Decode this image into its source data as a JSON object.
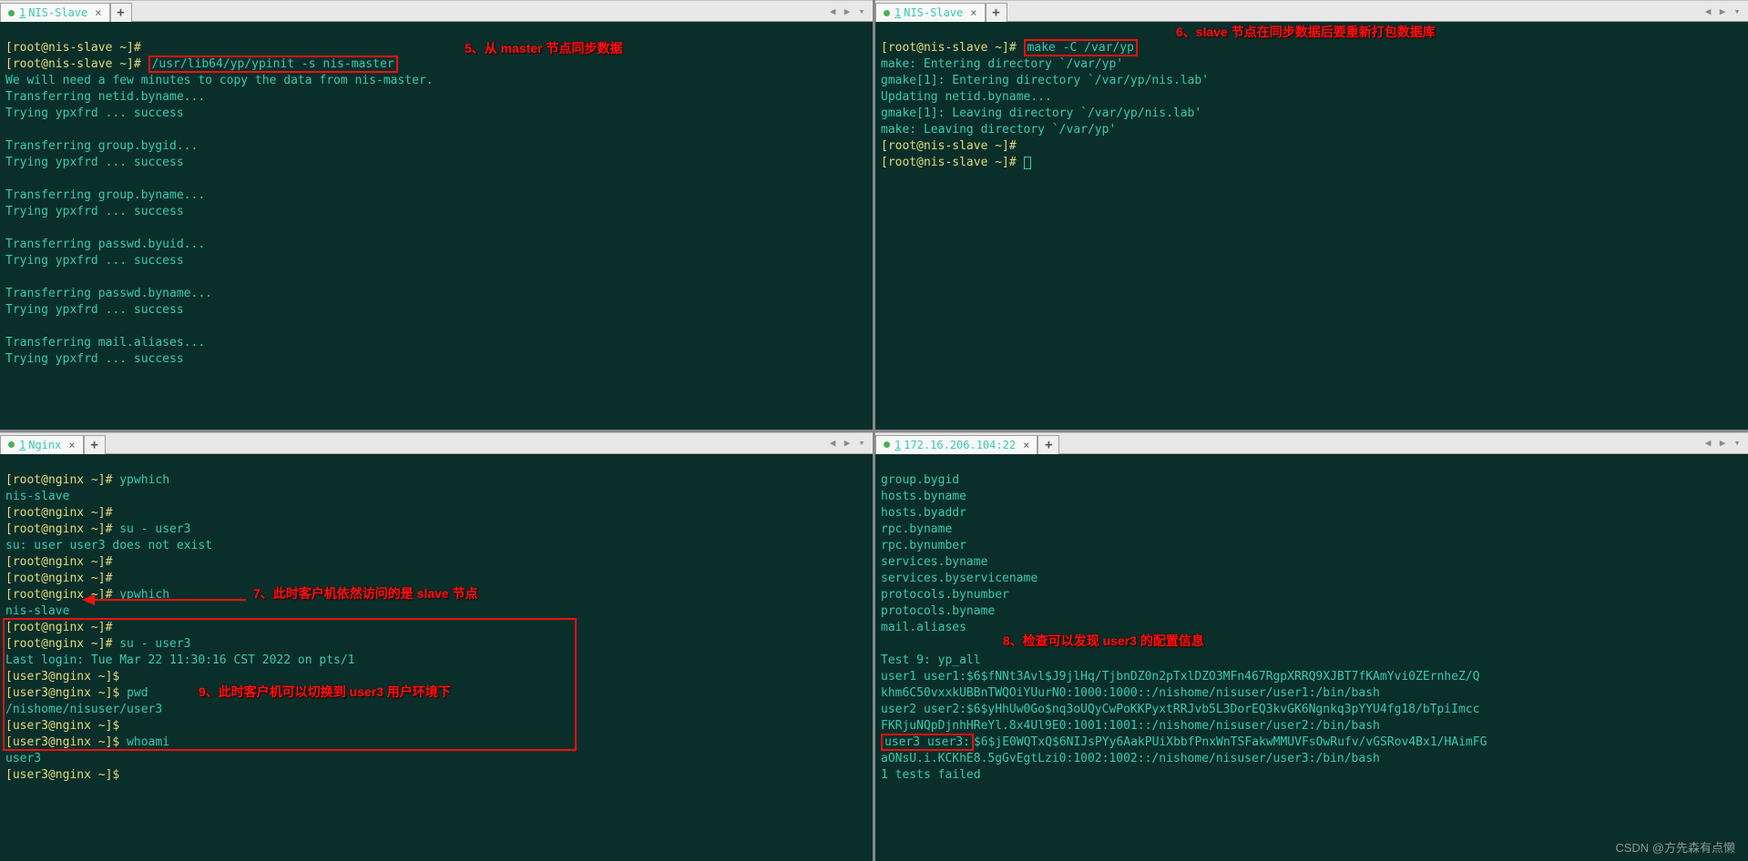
{
  "watermark": "CSDN @方先森有点懒",
  "panes": {
    "tl": {
      "tab": {
        "num": "1",
        "label": "NIS-Slave"
      },
      "annot5": "5、从 master 节点同步数据",
      "prompt1": "[root@nis-slave ~]#",
      "prompt2": "[root@nis-slave ~]#",
      "cmd2": "/usr/lib64/yp/ypinit -s nis-master",
      "lines": [
        "We will need a few minutes to copy the data from nis-master.",
        "Transferring netid.byname...",
        "Trying ypxfrd ... success",
        "",
        "Transferring group.bygid...",
        "Trying ypxfrd ... success",
        "",
        "Transferring group.byname...",
        "Trying ypxfrd ... success",
        "",
        "Transferring passwd.byuid...",
        "Trying ypxfrd ... success",
        "",
        "Transferring passwd.byname...",
        "Trying ypxfrd ... success",
        "",
        "Transferring mail.aliases...",
        "Trying ypxfrd ... success"
      ]
    },
    "tr": {
      "tab": {
        "num": "1",
        "label": "NIS-Slave"
      },
      "annot6": "6、slave 节点在同步数据后要重新打包数据库",
      "prompt1": "[root@nis-slave ~]#",
      "cmd1": "make -C /var/yp",
      "lines": [
        "make: Entering directory `/var/yp'",
        "gmake[1]: Entering directory `/var/yp/nis.lab'",
        "Updating netid.byname...",
        "gmake[1]: Leaving directory `/var/yp/nis.lab'",
        "make: Leaving directory `/var/yp'"
      ],
      "prompt2": "[root@nis-slave ~]#",
      "prompt3": "[root@nis-slave ~]#"
    },
    "bl": {
      "tab": {
        "num": "1",
        "label": "Nginx"
      },
      "annot7": "7、此时客户机依然访问的是 slave 节点",
      "annot9": "9、此时客户机可以切换到 user3 用户环境下",
      "rows": [
        {
          "p": "[root@nginx ~]#",
          "c": "ypwhich"
        },
        {
          "t": "nis-slave"
        },
        {
          "p": "[root@nginx ~]#"
        },
        {
          "p": "[root@nginx ~]#",
          "c": "su - user3"
        },
        {
          "t": "su: user user3 does not exist"
        },
        {
          "p": "[root@nginx ~]#"
        },
        {
          "p": "[root@nginx ~]#"
        },
        {
          "p": "[root@nginx ~]#",
          "c": "ypwhich"
        },
        {
          "t": "nis-slave"
        },
        {
          "p": "[root@nginx ~]#"
        },
        {
          "p": "[root@nginx ~]#",
          "c": "su - user3"
        },
        {
          "t": "Last login: Tue Mar 22 11:30:16 CST 2022 on pts/1"
        },
        {
          "p": "[user3@nginx ~]$"
        },
        {
          "p": "[user3@nginx ~]$",
          "c": "pwd"
        },
        {
          "t": "/nishome/nisuser/user3"
        },
        {
          "p": "[user3@nginx ~]$"
        },
        {
          "p": "[user3@nginx ~]$",
          "c": "whoami"
        },
        {
          "t": "user3"
        },
        {
          "p": "[user3@nginx ~]$"
        }
      ]
    },
    "br": {
      "tab": {
        "num": "1",
        "label": "172.16.206.104:22"
      },
      "annot8": "8、检查可以发现 user3 的配置信息",
      "lines_top": [
        "group.bygid",
        "hosts.byname",
        "hosts.byaddr",
        "rpc.byname",
        "rpc.bynumber",
        "services.byname",
        "services.byservicename",
        "protocols.bynumber",
        "protocols.byname",
        "mail.aliases",
        "",
        "Test 9: yp_all"
      ],
      "user_rows": [
        "user1 user1:$6$fNNt3Avl$J9jlHq/TjbnDZ0n2pTxlDZO3MFn467RgpXRRQ9XJBT7fKAmYvi0ZErnheZ/Q",
        "khm6C50vxxkUBBnTWQOiYUurN0:1000:1000::/nishome/nisuser/user1:/bin/bash",
        "user2 user2:$6$yHhUw0Go$nq3oUQyCwPoKKPyxtRRJvb5L3DorEQ3kvGK6Ngnkq3pYYU4fg18/bTpiImcc",
        "FKRjuNQpDjnhHReYl.8x4Ul9E0:1001:1001::/nishome/nisuser/user2:/bin/bash"
      ],
      "user3_label": "user3 user3:",
      "user3_rest": "$6$jE0WQTxQ$6NIJsPYy6AakPUiXbbfPnxWnTSFakwMMUVFsOwRufv/vGSRov4Bx1/HAimFG",
      "user3_line2": "aONsU.i.KCKhE8.5gGvEgtLzi0:1002:1002::/nishome/nisuser/user3:/bin/bash",
      "tests_failed": "1 tests failed"
    }
  }
}
